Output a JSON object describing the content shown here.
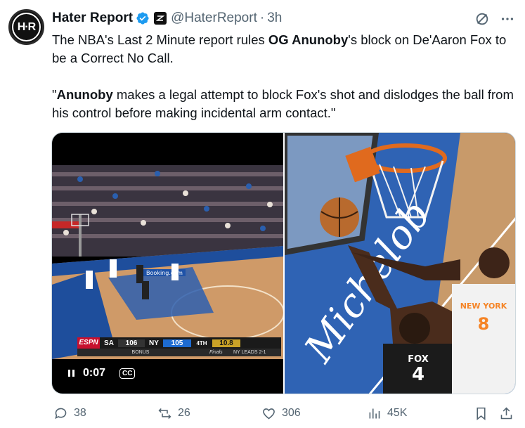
{
  "author": {
    "avatar_text": "H·R",
    "display_name": "Hater Report",
    "handle": "@HaterReport",
    "separator": "·",
    "time": "3h"
  },
  "tweet": {
    "line1_pre": "The NBA's Last 2 Minute report rules ",
    "line1_bold": "OG Anunoby",
    "line1_post": "'s block on De'Aaron Fox to be a Correct No Call.",
    "quote_pre": "\"",
    "quote_bold": "Anunoby",
    "quote_post": " makes a legal attempt to block Fox's shot and dislodges the ball from his control before making incidental arm contact.\""
  },
  "video": {
    "time": "0:07",
    "cc_label": "CC",
    "scorebug": {
      "network": "ESPN",
      "away_team": "SA",
      "away_score": "106",
      "home_team": "NY",
      "home_score": "105",
      "quarter": "4TH",
      "clock": "10.8",
      "bonus": "BONUS",
      "series": "NY LEADS 2-1",
      "finals": "Finals"
    },
    "ad_banner": "Booking.com"
  },
  "photo": {
    "jersey_fox_name": "FOX",
    "jersey_fox_number": "4",
    "jersey_og_team": "NEW YORK",
    "jersey_og_number": "8",
    "floor_text": "Michelob"
  },
  "actions": {
    "replies": "38",
    "reposts": "26",
    "likes": "306",
    "views": "45K"
  },
  "colors": {
    "verified": "#1d9bf0",
    "muted": "#536471",
    "text": "#0f1419",
    "knicks_orange": "#f58426",
    "knicks_blue": "#006bb6",
    "court_blue": "#2f63b4"
  }
}
